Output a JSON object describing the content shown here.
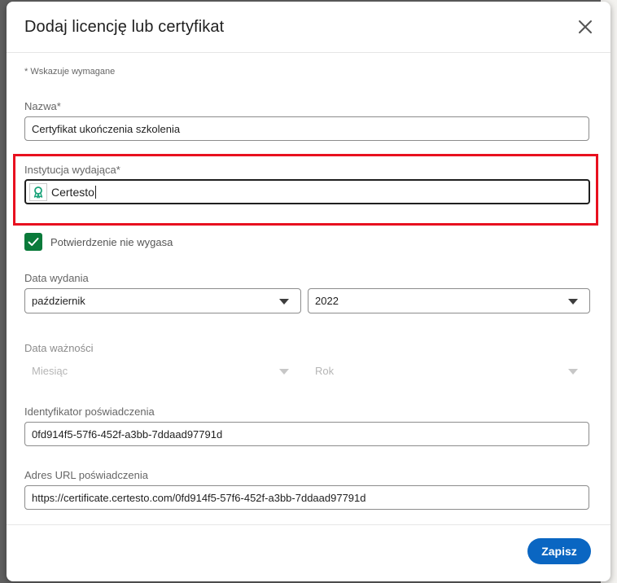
{
  "dialog": {
    "title": "Dodaj licencję lub certyfikat",
    "required_note": "* Wskazuje wymagane"
  },
  "fields": {
    "name": {
      "label": "Nazwa*",
      "value": "Certyfikat ukończenia szkolenia"
    },
    "issuer": {
      "label": "Instytucja wydająca*",
      "value": "Certesto",
      "logo_icon": "award-ribbon-icon"
    },
    "no_expiry": {
      "label": "Potwierdzenie nie wygasa",
      "checked": true
    },
    "issue_date": {
      "label": "Data wydania",
      "month": "październik",
      "year": "2022"
    },
    "expiry_date": {
      "label": "Data ważności",
      "month_placeholder": "Miesiąc",
      "year_placeholder": "Rok"
    },
    "credential_id": {
      "label": "Identyfikator poświadczenia",
      "value": "0fd914f5-57f6-452f-a3bb-7ddaad97791d"
    },
    "credential_url": {
      "label": "Adres URL poświadczenia",
      "value": "https://certificate.certesto.com/0fd914f5-57f6-452f-a3bb-7ddaad97791d"
    }
  },
  "footer": {
    "save_label": "Zapisz"
  },
  "colors": {
    "primary": "#0a66c2",
    "checkbox": "#0a7a3a",
    "highlight": "#e8101f",
    "issuer_logo": "#1aa37a"
  }
}
